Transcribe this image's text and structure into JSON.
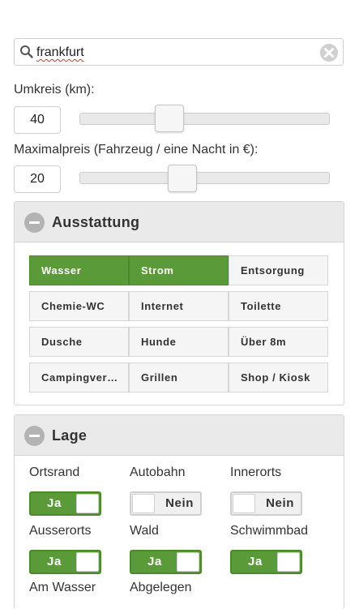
{
  "search": {
    "value": "frankfurt"
  },
  "radius": {
    "label": "Umkreis (km):",
    "value": "40",
    "slider_fraction": 0.34
  },
  "price": {
    "label": "Maximalpreis (Fahrzeug / eine Nacht in €):",
    "value": "20",
    "slider_fraction": 0.4
  },
  "ausstattung": {
    "title": "Ausstattung",
    "items": [
      {
        "label": "Wasser",
        "active": true
      },
      {
        "label": "Strom",
        "active": true
      },
      {
        "label": "Entsorgung",
        "active": false
      },
      {
        "label": "Chemie-WC",
        "active": false
      },
      {
        "label": "Internet",
        "active": false
      },
      {
        "label": "Toilette",
        "active": false
      },
      {
        "label": "Dusche",
        "active": false
      },
      {
        "label": "Hunde",
        "active": false
      },
      {
        "label": "Über 8m",
        "active": false
      },
      {
        "label": "Campingver…",
        "active": false
      },
      {
        "label": "Grillen",
        "active": false
      },
      {
        "label": "Shop / Kiosk",
        "active": false
      }
    ]
  },
  "lage": {
    "title": "Lage",
    "items": [
      {
        "label": "Ortsrand",
        "state": "Ja",
        "on": true
      },
      {
        "label": "Autobahn",
        "state": "Nein",
        "on": false
      },
      {
        "label": "Innerorts",
        "state": "Nein",
        "on": false
      },
      {
        "label": "Ausserorts",
        "state": "Ja",
        "on": true
      },
      {
        "label": "Wald",
        "state": "Ja",
        "on": true
      },
      {
        "label": "Schwimmbad",
        "state": "Ja",
        "on": true
      },
      {
        "label": "Am Wasser"
      },
      {
        "label": "Abgelegen"
      }
    ]
  },
  "colors": {
    "accent": "#5a9a38",
    "panel_header": "#eaeaea"
  }
}
